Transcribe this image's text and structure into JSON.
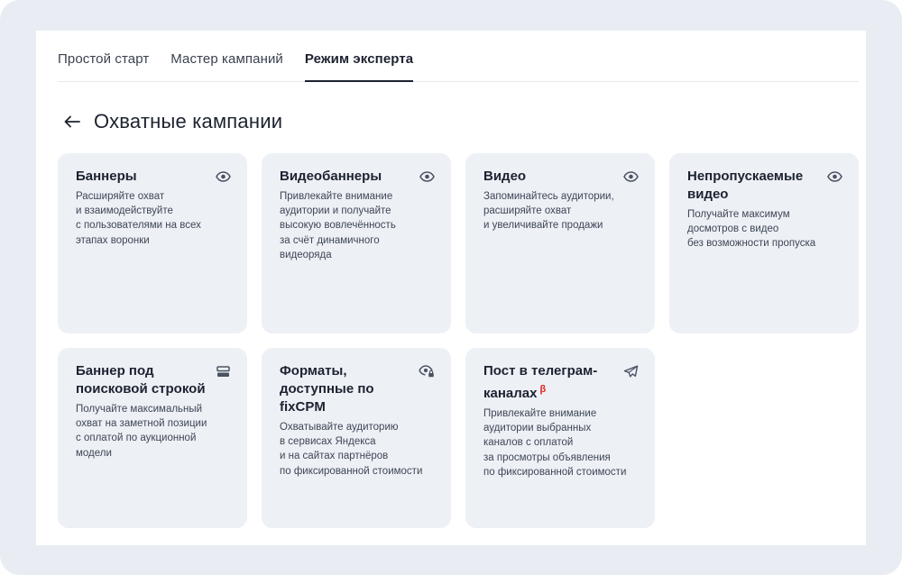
{
  "tabs": [
    {
      "label": "Простой старт",
      "active": false
    },
    {
      "label": "Мастер кампаний",
      "active": false
    },
    {
      "label": "Режим эксперта",
      "active": true
    }
  ],
  "page": {
    "back_icon": "arrow-left-icon",
    "title": "Охватные кампании"
  },
  "cards": [
    {
      "title": "Баннеры",
      "icon": "eye-icon",
      "description": "Расширяйте охват\nи взаимодействуйте\nс пользователями на всех\nэтапах воронки"
    },
    {
      "title": "Видеобаннеры",
      "icon": "eye-icon",
      "description": "Привлекайте внимание\nаудитории и получайте\nвысокую вовлечённость\nза счёт динамичного\nвидеоряда"
    },
    {
      "title": "Видео",
      "icon": "eye-icon",
      "description": "Запоминайтесь аудитории,\nрасширяйте охват\nи увеличивайте продажи"
    },
    {
      "title": "Непропускаемые видео",
      "icon": "eye-icon",
      "description": "Получайте максимум\nдосмотров с видео\nбез возможности пропуска"
    },
    {
      "title": "Баннер под поисковой строкой",
      "icon": "search-banner-icon",
      "description": "Получайте максимальный\nохват на заметной позиции\nс оплатой по аукционной\nмодели"
    },
    {
      "title": "Форматы, доступные по fixCPM",
      "icon": "eye-lock-icon",
      "description": "Охватывайте аудиторию\nв сервисах Яндекса\nи на сайтах партнёров\nпо фиксированной стоимости"
    },
    {
      "title": "Пост в телеграм-каналах",
      "badge": "β",
      "icon": "telegram-icon",
      "description": "Привлекайте внимание\nаудитории выбранных\nканалов с оплатой\nза просмотры объявления\nпо фиксированной стоимости"
    }
  ],
  "colors": {
    "frame_bg": "#e9edf3",
    "card_bg": "#edf0f5",
    "text": "#1c2230",
    "beta": "#e0221b"
  }
}
